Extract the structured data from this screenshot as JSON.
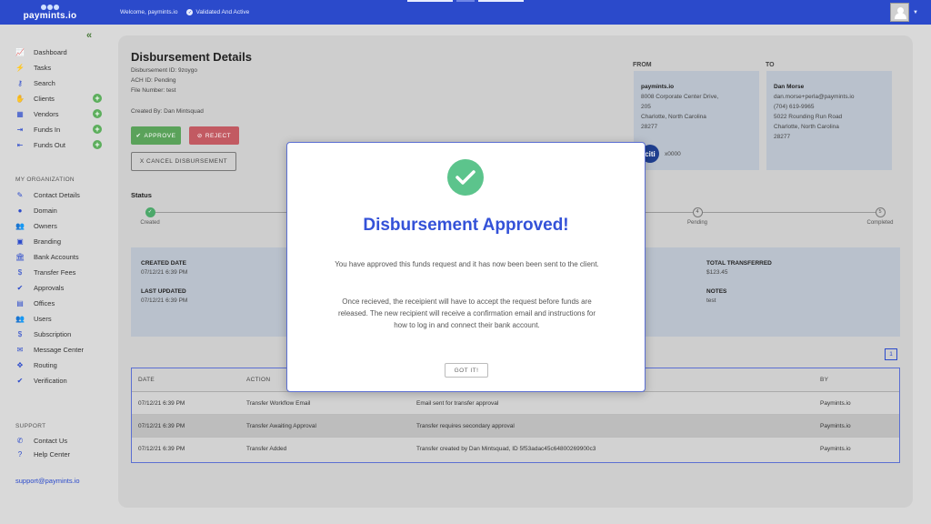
{
  "header": {
    "logo_text": "paymints.io",
    "welcome": "Welcome, paymints.io",
    "validated": "Validated And Active"
  },
  "sidebar": {
    "items": [
      {
        "label": "Dashboard",
        "icon": "chart-icon"
      },
      {
        "label": "Tasks",
        "icon": "bolt-icon"
      },
      {
        "label": "Search",
        "icon": "key-icon"
      },
      {
        "label": "Clients",
        "icon": "handshake-icon"
      },
      {
        "label": "Vendors",
        "icon": "building-icon"
      },
      {
        "label": "Funds In",
        "icon": "sign-in-icon"
      },
      {
        "label": "Funds Out",
        "icon": "sign-out-icon"
      }
    ],
    "org_label": "MY ORGANIZATION",
    "org_items": [
      {
        "label": "Contact Details",
        "icon": "pencil-icon"
      },
      {
        "label": "Domain",
        "icon": "globe-icon"
      },
      {
        "label": "Owners",
        "icon": "users-icon"
      },
      {
        "label": "Branding",
        "icon": "image-icon"
      },
      {
        "label": "Bank Accounts",
        "icon": "bank-icon"
      },
      {
        "label": "Transfer Fees",
        "icon": "dollar-icon"
      },
      {
        "label": "Approvals",
        "icon": "check-icon"
      },
      {
        "label": "Offices",
        "icon": "briefcase-icon"
      },
      {
        "label": "Users",
        "icon": "users-icon"
      },
      {
        "label": "Subscription",
        "icon": "dollar-icon"
      },
      {
        "label": "Message Center",
        "icon": "envelope-icon"
      },
      {
        "label": "Routing",
        "icon": "arrows-icon"
      },
      {
        "label": "Verification",
        "icon": "check-icon"
      }
    ],
    "support_label": "SUPPORT",
    "support_items": [
      {
        "label": "Contact Us",
        "icon": "phone-icon"
      },
      {
        "label": "Help Center",
        "icon": "question-icon"
      }
    ],
    "support_email": "support@paymints.io"
  },
  "details": {
    "title": "Disbursement Details",
    "disbursement_id": "Disbursement ID: 9zoygo",
    "ach_id": "ACH ID: Pending",
    "file_number": "File Number: test",
    "created_by": "Created By: Dan Mintsquad",
    "approve_label": "APPROVE",
    "reject_label": "REJECT",
    "cancel_label": "X CANCEL DISBURSEMENT"
  },
  "from": {
    "label": "FROM",
    "name": "paymints.io",
    "address1": "8008 Corporate Center Drive,",
    "address2": "205",
    "city": "Charlotte, North Carolina",
    "zip": "28277",
    "bank_logo": "citi",
    "account": "x0000"
  },
  "to": {
    "label": "TO",
    "name": "Dan Morse",
    "email": "dan.morse+perla@paymints.io",
    "phone": "(704) 619-9965",
    "address": "5022 Rounding Run Road",
    "city": "Charlotte, North Carolina",
    "zip": "28277"
  },
  "status": {
    "label": "Status",
    "steps": [
      {
        "num": "✓",
        "label": "Created",
        "done": true
      },
      {
        "num": "4",
        "label": "Pending",
        "done": false
      },
      {
        "num": "5",
        "label": "Completed",
        "done": false
      }
    ]
  },
  "info": {
    "created_date_label": "CREATED DATE",
    "created_date": "07/12/21 6:39 PM",
    "last_updated_label": "LAST UPDATED",
    "last_updated": "07/12/21 6:39 PM",
    "total_label": "TOTAL TRANSFERRED",
    "total": "$123.45",
    "notes_label": "NOTES",
    "notes": "test"
  },
  "pagination": {
    "page": "1"
  },
  "history": {
    "columns": [
      "DATE",
      "ACTION",
      "",
      "BY"
    ],
    "rows": [
      {
        "date": "07/12/21 6:39 PM",
        "action": "Transfer Workflow Email",
        "detail": "Email sent for transfer approval",
        "by": "Paymints.io"
      },
      {
        "date": "07/12/21 6:39 PM",
        "action": "Transfer Awaiting Approval",
        "detail": "Transfer requires secondary approval",
        "by": "Paymints.io"
      },
      {
        "date": "07/12/21 6:39 PM",
        "action": "Transfer Added",
        "detail": "Transfer created by Dan Mintsquad, ID 5f53adac45c64800269900c3",
        "by": "Paymints.io"
      }
    ]
  },
  "modal": {
    "title": "Disbursement Approved!",
    "p1": "You have approved this funds request and it has now been been sent to the client.",
    "p2": "Once recieved, the receipient will have to accept the request before funds are released. The new recipient will receive a confirmation email and instructions for how to log in and connect their bank account.",
    "button": "GOT IT!"
  },
  "colors": {
    "brand": "#2b4acb",
    "approve": "#5aa25a",
    "reject": "#c25a62",
    "success": "#5cc48c"
  }
}
